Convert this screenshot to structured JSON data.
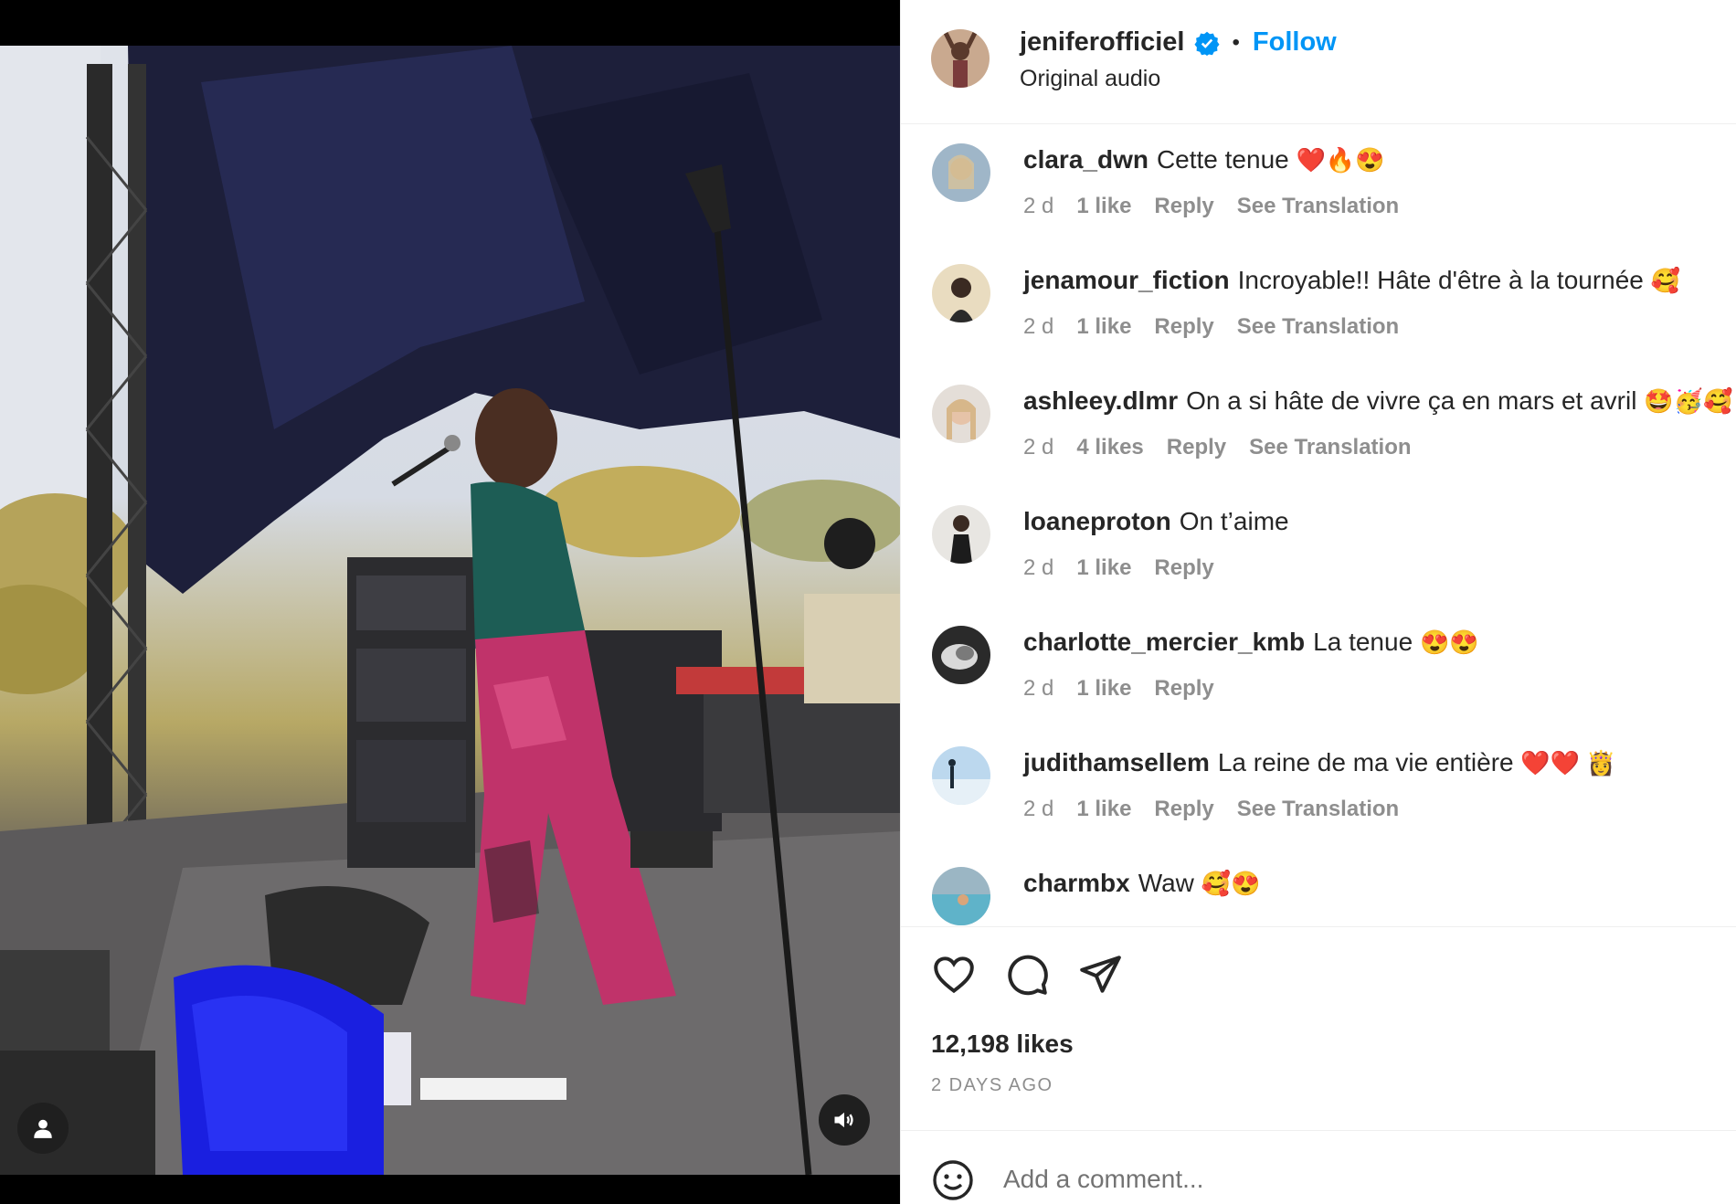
{
  "media": {
    "profile_icon": "user-icon",
    "sound_icon": "speaker-icon"
  },
  "post": {
    "author": "jeniferofficiel",
    "verified_icon": "verified-badge-icon",
    "separator": "•",
    "follow_label": "Follow",
    "audio": "Original audio"
  },
  "comments": [
    {
      "user": "clara_dwn",
      "text": "Cette tenue",
      "emoji": "❤️🔥😍",
      "time": "2 d",
      "likes": "1 like",
      "reply": "Reply",
      "translate": "See Translation"
    },
    {
      "user": "jenamour_fiction",
      "text": "Incroyable!! Hâte d'être à la tournée",
      "emoji": "🥰",
      "time": "2 d",
      "likes": "1 like",
      "reply": "Reply",
      "translate": "See Translation"
    },
    {
      "user": "ashleey.dlmr",
      "text": "On a si hâte de vivre ça en mars et avril",
      "emoji": "🤩🥳🥰",
      "time": "2 d",
      "likes": "4 likes",
      "reply": "Reply",
      "translate": "See Translation"
    },
    {
      "user": "loaneproton",
      "text": "On t’aime",
      "emoji": "",
      "time": "2 d",
      "likes": "1 like",
      "reply": "Reply",
      "translate": ""
    },
    {
      "user": "charlotte_mercier_kmb",
      "text": "La tenue",
      "emoji": "😍😍",
      "time": "2 d",
      "likes": "1 like",
      "reply": "Reply",
      "translate": ""
    },
    {
      "user": "judithamsellem",
      "text": "La reine de ma vie entière",
      "emoji": "❤️❤️ 👸",
      "time": "2 d",
      "likes": "1 like",
      "reply": "Reply",
      "translate": "See Translation"
    },
    {
      "user": "charmbx",
      "text": "Waw",
      "emoji": "🥰😍",
      "time": "",
      "likes": "",
      "reply": "",
      "translate": ""
    }
  ],
  "actions": {
    "like_icon": "heart-icon",
    "comment_icon": "comment-icon",
    "share_icon": "send-icon",
    "likes": "12,198 likes",
    "date": "2 DAYS AGO"
  },
  "add_comment": {
    "emoji_icon": "smiley-icon",
    "placeholder": "Add a comment..."
  },
  "colors": {
    "accent": "#0095f6",
    "muted": "#8e8e8e",
    "text": "#262626"
  }
}
